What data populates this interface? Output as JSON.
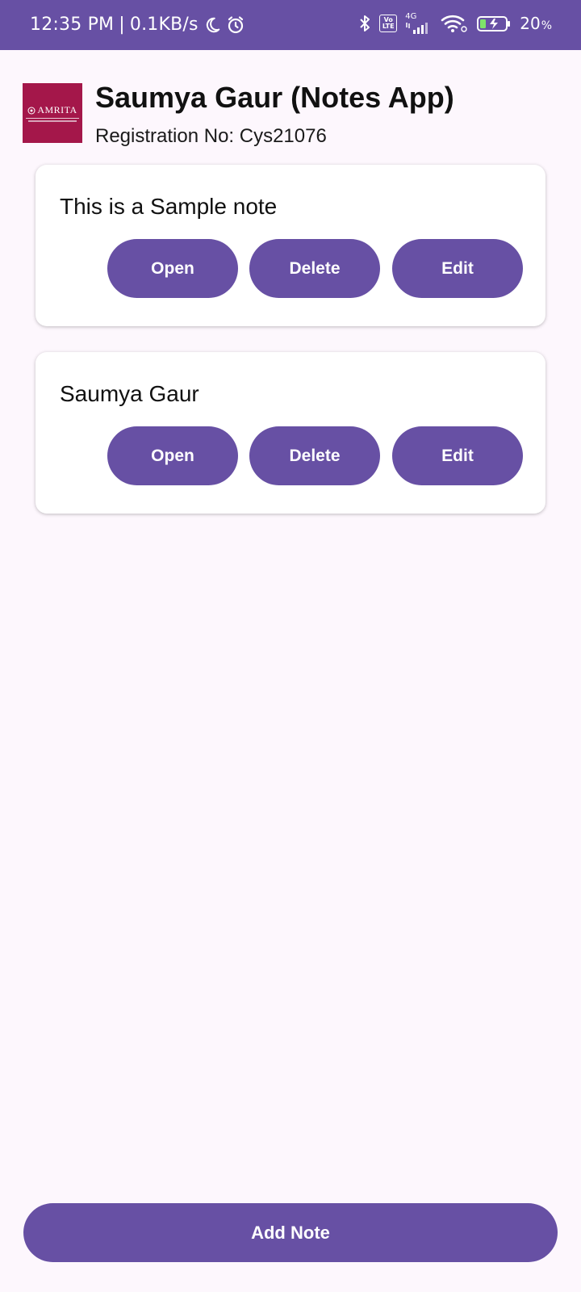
{
  "status_bar": {
    "time": "12:35 PM",
    "net_speed": "0.1KB/s",
    "network_type": "4G",
    "volte": "Vo LTE",
    "battery_percent": "20",
    "battery_unit": "%",
    "icons": [
      "moon-icon",
      "alarm-icon",
      "bluetooth-icon",
      "volte-icon",
      "signal-icon",
      "wifi-icon",
      "battery-charging-icon"
    ],
    "bg_color": "#6750a4"
  },
  "header": {
    "logo_text": "AMRITA",
    "title": "Saumya Gaur (Notes App)",
    "registration": "Registration No: Cys21076"
  },
  "notes": [
    {
      "title": "This is a Sample note",
      "open_label": "Open",
      "delete_label": "Delete",
      "edit_label": "Edit"
    },
    {
      "title": "Saumya Gaur",
      "open_label": "Open",
      "delete_label": "Delete",
      "edit_label": "Edit"
    }
  ],
  "add_note_label": "Add Note",
  "colors": {
    "accent": "#6750a4",
    "background": "#fdf7fd",
    "logo_bg": "#a4174a"
  }
}
